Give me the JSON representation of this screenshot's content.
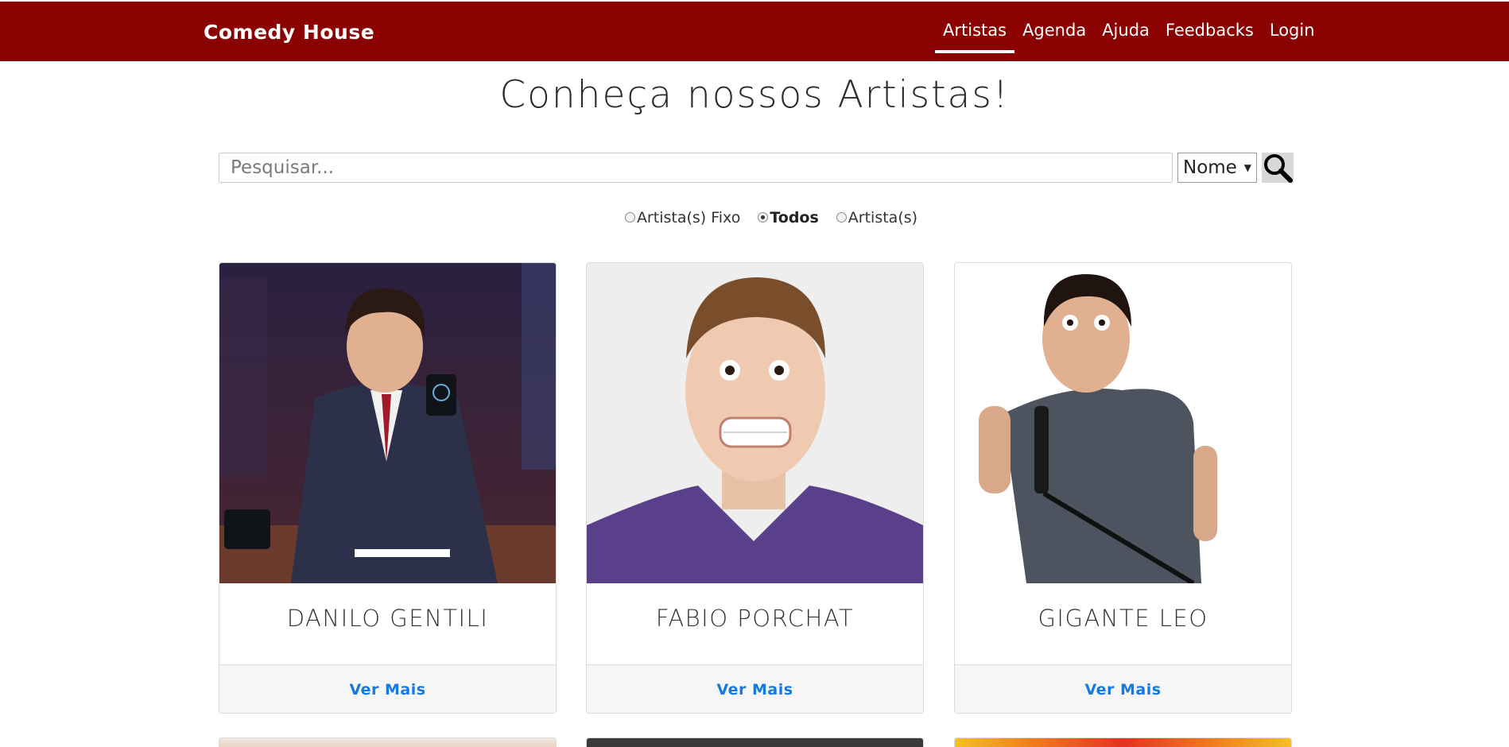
{
  "navbar": {
    "brand": "Comedy House",
    "links": [
      {
        "label": "Artistas",
        "active": true
      },
      {
        "label": "Agenda",
        "active": false
      },
      {
        "label": "Ajuda",
        "active": false
      },
      {
        "label": "Feedbacks",
        "active": false
      },
      {
        "label": "Login",
        "active": false
      }
    ],
    "color": "#8b0000"
  },
  "page": {
    "title": "Conheça nossos Artistas!"
  },
  "search": {
    "placeholder": "Pesquisar...",
    "value": "",
    "select_value": "Nome",
    "button_icon": "search-icon"
  },
  "filters": [
    {
      "label": "Artista(s) Fixo",
      "checked": false
    },
    {
      "label": "Todos",
      "checked": true
    },
    {
      "label": "Artista(s)",
      "checked": false
    }
  ],
  "artists": [
    {
      "name": "DANILO GENTILI",
      "action": "Ver Mais"
    },
    {
      "name": "FABIO PORCHAT",
      "action": "Ver Mais"
    },
    {
      "name": "GIGANTE LEO",
      "action": "Ver Mais"
    }
  ],
  "accent_color": "#1479e0"
}
